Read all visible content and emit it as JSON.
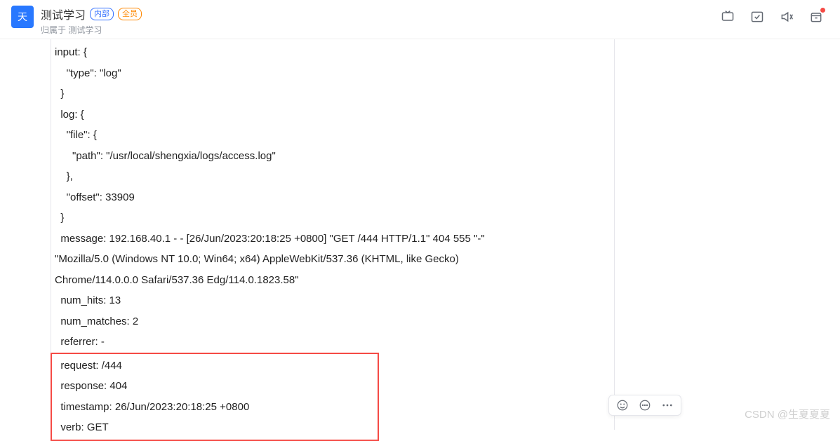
{
  "header": {
    "app_icon_text": "天",
    "title": "测试学习",
    "badge_internal": "内部",
    "badge_all": "全员",
    "sub_prefix": "归属于 ",
    "sub_link": "测试学习"
  },
  "log": {
    "l1": "input: {",
    "l2": "    \"type\": \"log\"",
    "l3": "  }",
    "l4": "  log: {",
    "l5": "    \"file\": {",
    "l6": "      \"path\": \"/usr/local/shengxia/logs/access.log\"",
    "l7": "    },",
    "l8": "    \"offset\": 33909",
    "l9": "  }",
    "l10a": "  message: 192.168.40.1 - - [26/Jun/2023:20:18:25 +0800] \"GET /444 HTTP/1.1\" 404 555 \"-\"",
    "l10b": "\"Mozilla/5.0 (Windows NT 10.0; Win64; x64) AppleWebKit/537.36 (KHTML, like Gecko)",
    "l10c": "Chrome/114.0.0.0 Safari/537.36 Edg/114.0.1823.58\"",
    "l11": "  num_hits: 13",
    "l12": "  num_matches: 2",
    "l13": "  referrer: -",
    "h1": "  request: /444",
    "h2": "  response: 404",
    "h3": "  timestamp: 26/Jun/2023:20:18:25 +0800",
    "h4": "  verb: GET"
  },
  "watermark": "CSDN @生夏夏夏"
}
